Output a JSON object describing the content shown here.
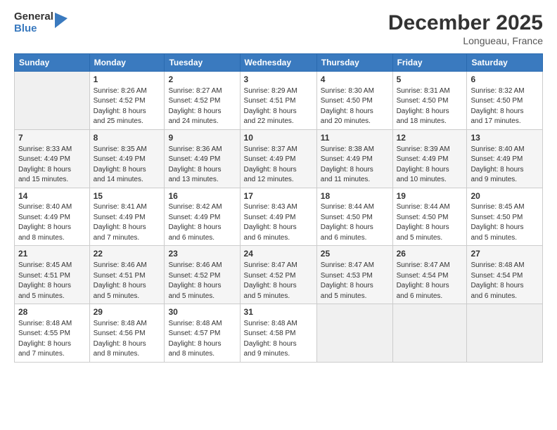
{
  "logo": {
    "general": "General",
    "blue": "Blue"
  },
  "title": "December 2025",
  "subtitle": "Longueau, France",
  "days_header": [
    "Sunday",
    "Monday",
    "Tuesday",
    "Wednesday",
    "Thursday",
    "Friday",
    "Saturday"
  ],
  "weeks": [
    [
      {
        "num": "",
        "info": ""
      },
      {
        "num": "1",
        "info": "Sunrise: 8:26 AM\nSunset: 4:52 PM\nDaylight: 8 hours\nand 25 minutes."
      },
      {
        "num": "2",
        "info": "Sunrise: 8:27 AM\nSunset: 4:52 PM\nDaylight: 8 hours\nand 24 minutes."
      },
      {
        "num": "3",
        "info": "Sunrise: 8:29 AM\nSunset: 4:51 PM\nDaylight: 8 hours\nand 22 minutes."
      },
      {
        "num": "4",
        "info": "Sunrise: 8:30 AM\nSunset: 4:50 PM\nDaylight: 8 hours\nand 20 minutes."
      },
      {
        "num": "5",
        "info": "Sunrise: 8:31 AM\nSunset: 4:50 PM\nDaylight: 8 hours\nand 18 minutes."
      },
      {
        "num": "6",
        "info": "Sunrise: 8:32 AM\nSunset: 4:50 PM\nDaylight: 8 hours\nand 17 minutes."
      }
    ],
    [
      {
        "num": "7",
        "info": "Sunrise: 8:33 AM\nSunset: 4:49 PM\nDaylight: 8 hours\nand 15 minutes."
      },
      {
        "num": "8",
        "info": "Sunrise: 8:35 AM\nSunset: 4:49 PM\nDaylight: 8 hours\nand 14 minutes."
      },
      {
        "num": "9",
        "info": "Sunrise: 8:36 AM\nSunset: 4:49 PM\nDaylight: 8 hours\nand 13 minutes."
      },
      {
        "num": "10",
        "info": "Sunrise: 8:37 AM\nSunset: 4:49 PM\nDaylight: 8 hours\nand 12 minutes."
      },
      {
        "num": "11",
        "info": "Sunrise: 8:38 AM\nSunset: 4:49 PM\nDaylight: 8 hours\nand 11 minutes."
      },
      {
        "num": "12",
        "info": "Sunrise: 8:39 AM\nSunset: 4:49 PM\nDaylight: 8 hours\nand 10 minutes."
      },
      {
        "num": "13",
        "info": "Sunrise: 8:40 AM\nSunset: 4:49 PM\nDaylight: 8 hours\nand 9 minutes."
      }
    ],
    [
      {
        "num": "14",
        "info": "Sunrise: 8:40 AM\nSunset: 4:49 PM\nDaylight: 8 hours\nand 8 minutes."
      },
      {
        "num": "15",
        "info": "Sunrise: 8:41 AM\nSunset: 4:49 PM\nDaylight: 8 hours\nand 7 minutes."
      },
      {
        "num": "16",
        "info": "Sunrise: 8:42 AM\nSunset: 4:49 PM\nDaylight: 8 hours\nand 6 minutes."
      },
      {
        "num": "17",
        "info": "Sunrise: 8:43 AM\nSunset: 4:49 PM\nDaylight: 8 hours\nand 6 minutes."
      },
      {
        "num": "18",
        "info": "Sunrise: 8:44 AM\nSunset: 4:50 PM\nDaylight: 8 hours\nand 6 minutes."
      },
      {
        "num": "19",
        "info": "Sunrise: 8:44 AM\nSunset: 4:50 PM\nDaylight: 8 hours\nand 5 minutes."
      },
      {
        "num": "20",
        "info": "Sunrise: 8:45 AM\nSunset: 4:50 PM\nDaylight: 8 hours\nand 5 minutes."
      }
    ],
    [
      {
        "num": "21",
        "info": "Sunrise: 8:45 AM\nSunset: 4:51 PM\nDaylight: 8 hours\nand 5 minutes."
      },
      {
        "num": "22",
        "info": "Sunrise: 8:46 AM\nSunset: 4:51 PM\nDaylight: 8 hours\nand 5 minutes."
      },
      {
        "num": "23",
        "info": "Sunrise: 8:46 AM\nSunset: 4:52 PM\nDaylight: 8 hours\nand 5 minutes."
      },
      {
        "num": "24",
        "info": "Sunrise: 8:47 AM\nSunset: 4:52 PM\nDaylight: 8 hours\nand 5 minutes."
      },
      {
        "num": "25",
        "info": "Sunrise: 8:47 AM\nSunset: 4:53 PM\nDaylight: 8 hours\nand 5 minutes."
      },
      {
        "num": "26",
        "info": "Sunrise: 8:47 AM\nSunset: 4:54 PM\nDaylight: 8 hours\nand 6 minutes."
      },
      {
        "num": "27",
        "info": "Sunrise: 8:48 AM\nSunset: 4:54 PM\nDaylight: 8 hours\nand 6 minutes."
      }
    ],
    [
      {
        "num": "28",
        "info": "Sunrise: 8:48 AM\nSunset: 4:55 PM\nDaylight: 8 hours\nand 7 minutes."
      },
      {
        "num": "29",
        "info": "Sunrise: 8:48 AM\nSunset: 4:56 PM\nDaylight: 8 hours\nand 8 minutes."
      },
      {
        "num": "30",
        "info": "Sunrise: 8:48 AM\nSunset: 4:57 PM\nDaylight: 8 hours\nand 8 minutes."
      },
      {
        "num": "31",
        "info": "Sunrise: 8:48 AM\nSunset: 4:58 PM\nDaylight: 8 hours\nand 9 minutes."
      },
      {
        "num": "",
        "info": ""
      },
      {
        "num": "",
        "info": ""
      },
      {
        "num": "",
        "info": ""
      }
    ]
  ]
}
